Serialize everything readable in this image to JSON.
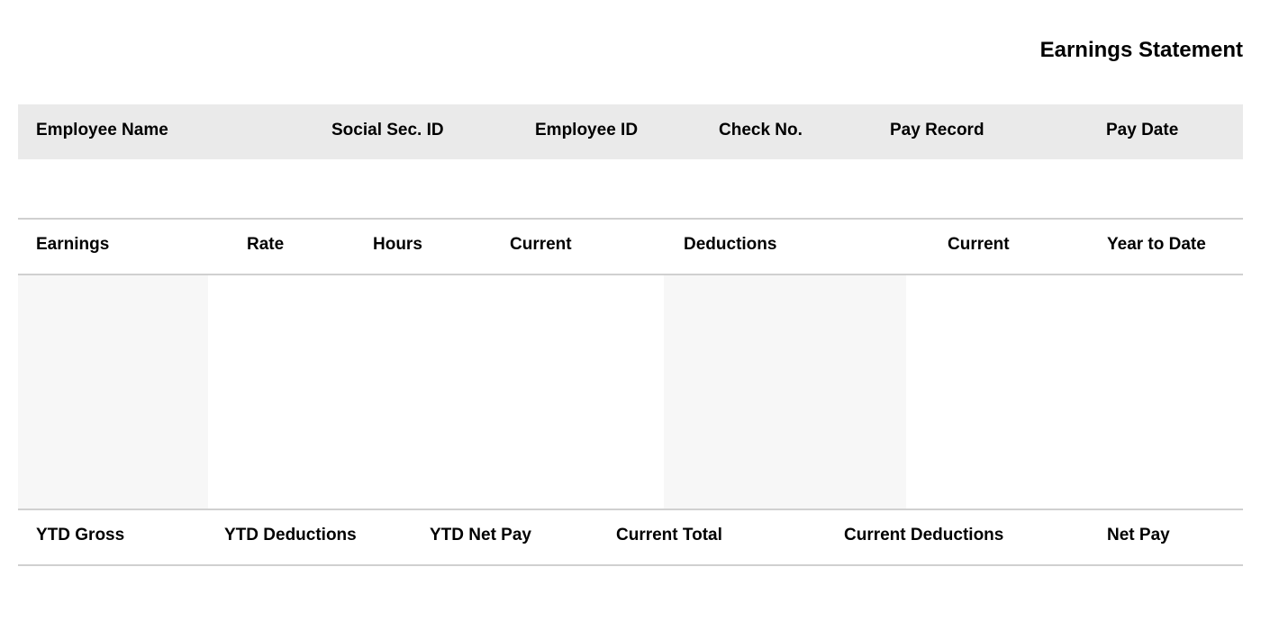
{
  "title": "Earnings Statement",
  "employee_header": {
    "columns": [
      "Employee Name",
      "Social Sec. ID",
      "Employee ID",
      "Check No.",
      "Pay Record",
      "Pay Date"
    ],
    "values": [
      "",
      "",
      "",
      "",
      "",
      ""
    ]
  },
  "earnings_table": {
    "columns": [
      "Earnings",
      "Rate",
      "Hours",
      "Current",
      "Deductions",
      "Current",
      "Year to Date"
    ],
    "rows": []
  },
  "summary": {
    "columns": [
      "YTD Gross",
      "YTD Deductions",
      "YTD Net Pay",
      "Current Total",
      "Current Deductions",
      "Net Pay"
    ],
    "values": [
      "",
      "",
      "",
      "",
      "",
      ""
    ]
  }
}
